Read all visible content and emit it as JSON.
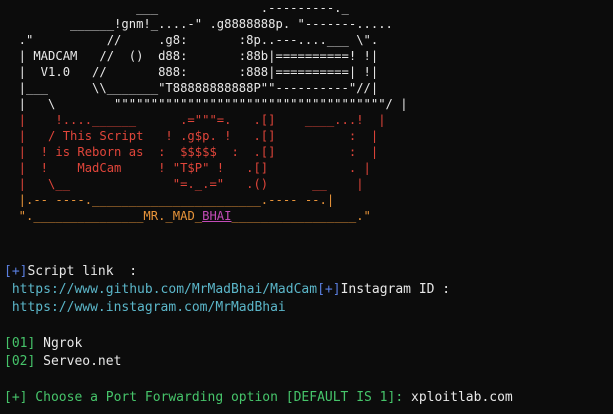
{
  "banner": {
    "lines": [
      [
        [
          "                  ___              .---------._",
          "white"
        ]
      ],
      [
        [
          "         ______!gnm!_....-\" .g8888888p. \"-------.....",
          "white"
        ]
      ],
      [
        [
          "  .\"          //     .g8:       :8p..---....___ \\\".",
          "white"
        ]
      ],
      [
        [
          "  | MADCAM   //  ()  d88:       :88b|==========! !|",
          "white"
        ]
      ],
      [
        [
          "  |  V1.0   //       888:       :888|==========| !|",
          "white"
        ]
      ],
      [
        [
          "  |___      \\\\_______\"T88888888888P\"\"----------\"//|",
          "white"
        ]
      ],
      [
        [
          "  |   \\        \"\"\"\"\"\"\"\"\"\"\"\"\"\"\"\"\"\"\"\"\"\"\"\"\"\"\"\"\"\"\"\"\"\"\"\"\"/ |",
          "white"
        ]
      ],
      [
        [
          "  |    !....______      .=\"\"\"=.   .[]    ____...!  |",
          "red"
        ]
      ],
      [
        [
          "  |   / This Script   ! .g$p. !   .[]          :  |",
          "red"
        ]
      ],
      [
        [
          "  |  ! is Reborn as  :  $$$$$  :  .[]          :  |",
          "red"
        ]
      ],
      [
        [
          "  |  !    MadCam     ! \"T$P\" !   .[]           . |",
          "red"
        ]
      ],
      [
        [
          "  |   \\__              \"=._.=\"   .()      __    |",
          "red"
        ]
      ],
      [
        [
          "  |.-- ----._______________________.---- --.|",
          "orange"
        ]
      ],
      [
        [
          "  \"._______________MR._MAD_BHAI_________________.\"",
          "orange"
        ]
      ]
    ],
    "author_tag": "MR._MAD_BHAI"
  },
  "script_link": {
    "prefix": "[+]",
    "label": "Script link  :",
    "github_url": "https://www.github.com/MrMadBhai/MadCam",
    "instagram_prefix": "[+]",
    "instagram_label": "Instagram ID :",
    "instagram_url": "https://www.instagram.com/MrMadBhai"
  },
  "options": [
    {
      "index": "[01]",
      "label": "Ngrok"
    },
    {
      "index": "[02]",
      "label": "Serveo.net"
    }
  ],
  "prompt": {
    "text": "[+] Choose a Port Forwarding option [DEFAULT IS 1]: ",
    "input_value": "xploitlab.com"
  },
  "colors": {
    "background": "#0c0c0c",
    "white": "#e8e8e8",
    "red": "#e0453a",
    "yellow": "#e5d84a",
    "orange": "#e8943a",
    "green": "#46c46a",
    "cyan": "#5bb6c9",
    "magenta": "#c34bb8"
  }
}
